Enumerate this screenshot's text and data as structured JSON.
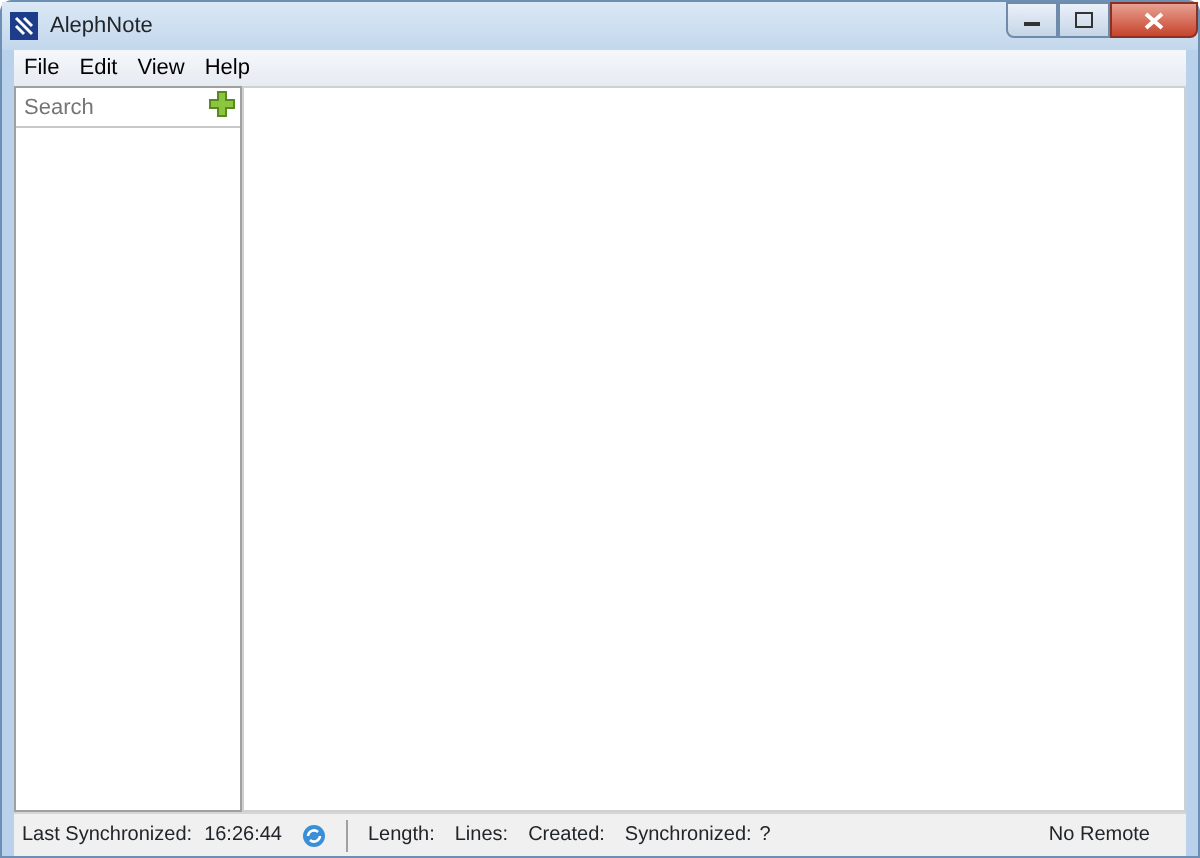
{
  "window": {
    "title": "AlephNote"
  },
  "menu": [
    "File",
    "Edit",
    "View",
    "Help"
  ],
  "search": {
    "placeholder": "Search"
  },
  "status_bar": {
    "last_synchronized_label": "Last Synchronized:",
    "last_synchronized": "16:26:44",
    "length_label": "Length:",
    "lines_label": "Lines:",
    "created_label": "Created:",
    "synchronized_label": "Synchronized:",
    "synchronized": "?",
    "remote": "No Remote"
  }
}
